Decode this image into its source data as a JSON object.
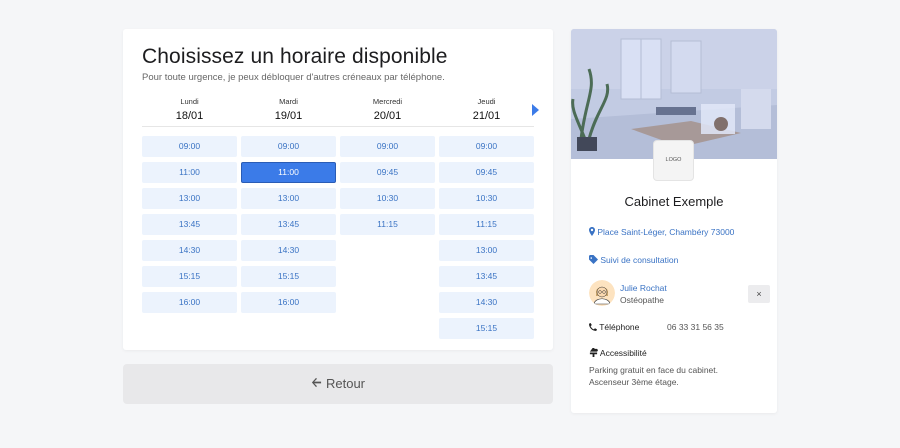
{
  "booking": {
    "title": "Choisissez un horaire disponible",
    "subtitle": "Pour toute urgence, je peux débloquer d'autres créneaux par téléphone.",
    "days": [
      {
        "name": "Lundi",
        "date": "18/01",
        "slots": [
          "09:00",
          "11:00",
          "13:00",
          "13:45",
          "14:30",
          "15:15",
          "16:00"
        ]
      },
      {
        "name": "Mardi",
        "date": "19/01",
        "slots": [
          "09:00",
          "11:00",
          "13:00",
          "13:45",
          "14:30",
          "15:15",
          "16:00"
        ]
      },
      {
        "name": "Mercredi",
        "date": "20/01",
        "slots": [
          "09:00",
          "09:45",
          "10:30",
          "11:15"
        ]
      },
      {
        "name": "Jeudi",
        "date": "21/01",
        "slots": [
          "09:00",
          "09:45",
          "10:30",
          "11:15",
          "13:00",
          "13:45",
          "14:30",
          "15:15"
        ]
      }
    ],
    "selected": {
      "day": 1,
      "slot": 1
    },
    "next_icon": "chevron-right-icon"
  },
  "back_button": {
    "label": "Retour",
    "icon": "arrow-left-icon"
  },
  "cabinet": {
    "logo_text": "LOGO",
    "name": "Cabinet Exemple",
    "address": "Place Saint-Léger, Chambéry 73000",
    "address_icon": "map-pin-icon",
    "suivi_label": "Suivi de consultation",
    "suivi_icon": "tag-icon",
    "doctor": {
      "name": "Julie Rochat",
      "role": "Ostéopathe",
      "close": "×"
    },
    "phone_label": "Téléphone",
    "phone_icon": "phone-icon",
    "phone_value": "06 33 31 56 35",
    "access_label": "Accessibilité",
    "access_icon": "signpost-icon",
    "access_lines": [
      "Parking gratuit en face du cabinet.",
      "Ascenseur 3ème étage."
    ]
  },
  "colors": {
    "accent": "#3b7be8",
    "slot_bg": "#ecf3fd",
    "slot_text": "#3a73c4"
  }
}
